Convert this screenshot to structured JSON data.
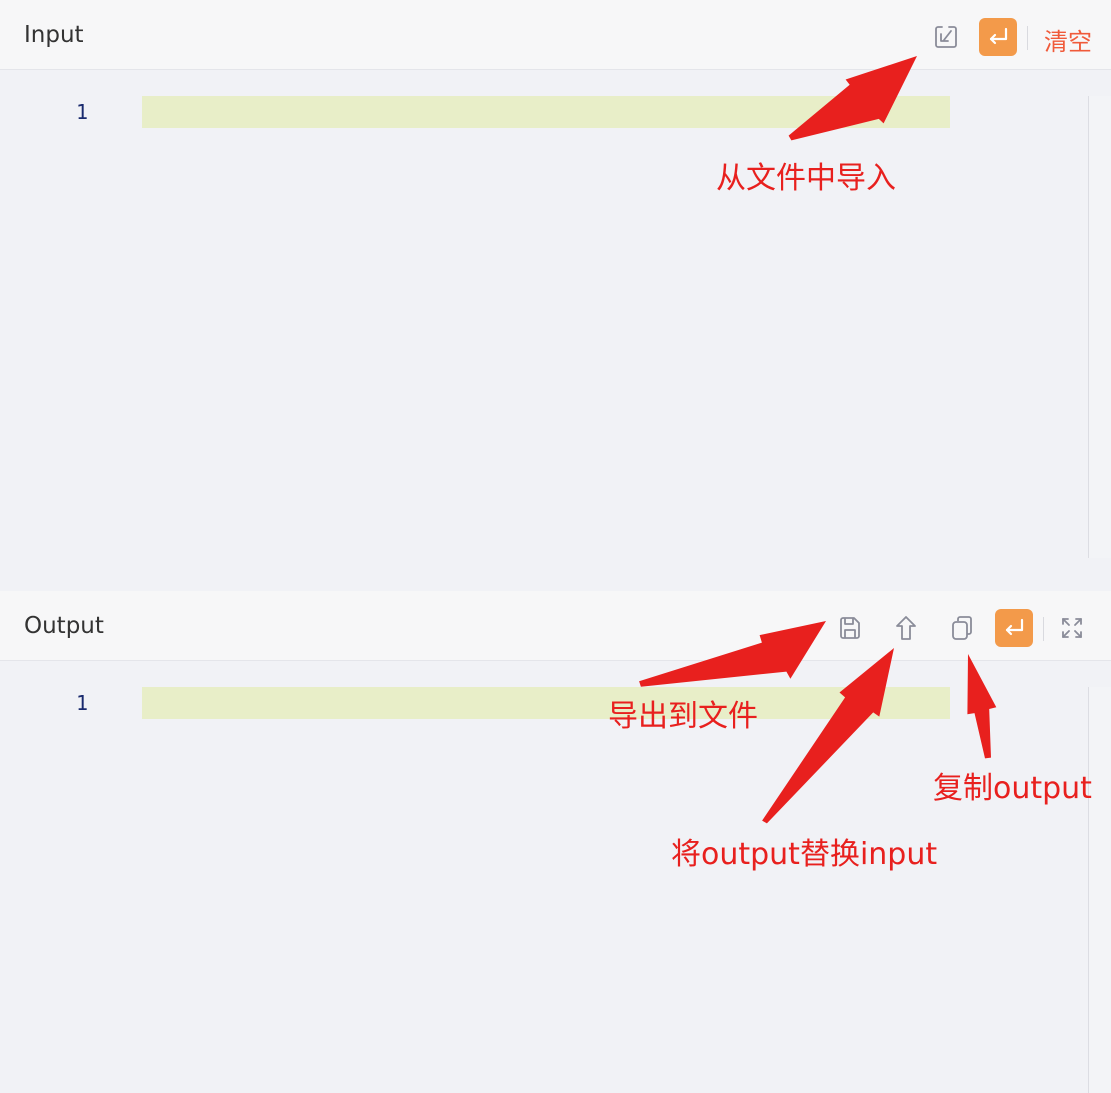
{
  "input": {
    "title": "Input",
    "tools": {
      "import_icon": "import-file-icon",
      "wrap_icon": "wrap-return-icon",
      "clear_label": "清空"
    },
    "line_numbers": [
      "1"
    ]
  },
  "output": {
    "title": "Output",
    "tools": {
      "save_icon": "save-floppy-icon",
      "replace_icon": "arrow-up-icon",
      "copy_icon": "copy-icon",
      "wrap_icon": "wrap-return-icon",
      "fullscreen_icon": "fullscreen-expand-icon"
    },
    "line_numbers": [
      "1"
    ]
  },
  "annotations": {
    "import_from_file": "从文件中导入",
    "export_to_file": "导出到文件",
    "replace_input": "将output替换input",
    "copy_output": "复制output"
  },
  "colors": {
    "accent_orange": "#f39a4a",
    "danger_red": "#f05a3a",
    "annotation_red": "#e8201e",
    "active_line": "#e8eec8"
  }
}
